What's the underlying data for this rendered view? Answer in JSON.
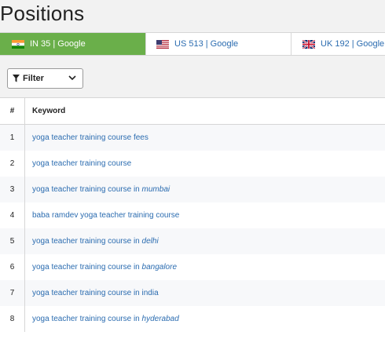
{
  "page": {
    "title": "Positions"
  },
  "tabs": [
    {
      "label": "IN 35 | Google",
      "flag": "flag-in-icon",
      "active": true
    },
    {
      "label": "US 513 | Google",
      "flag": "flag-us-icon",
      "active": false
    },
    {
      "label": "UK 192 | Google",
      "flag": "flag-uk-icon",
      "active": false
    }
  ],
  "filter": {
    "label": "Filter"
  },
  "table": {
    "headers": {
      "num": "#",
      "keyword": "Keyword"
    },
    "rows": [
      {
        "num": "1",
        "keyword": "yoga teacher training course fees",
        "suffix": ""
      },
      {
        "num": "2",
        "keyword": "yoga teacher training course",
        "suffix": ""
      },
      {
        "num": "3",
        "keyword": "yoga teacher training course in ",
        "suffix": "mumbai"
      },
      {
        "num": "4",
        "keyword": "baba ramdev yoga teacher training course",
        "suffix": ""
      },
      {
        "num": "5",
        "keyword": "yoga teacher training course in ",
        "suffix": "delhi"
      },
      {
        "num": "6",
        "keyword": "yoga teacher training course in ",
        "suffix": "bangalore"
      },
      {
        "num": "7",
        "keyword": "yoga teacher training course in india",
        "suffix": ""
      },
      {
        "num": "8",
        "keyword": "yoga teacher training course in ",
        "suffix": "hyderabad"
      }
    ]
  },
  "colors": {
    "active_tab": "#6aaf4a",
    "link": "#2b6cb0"
  }
}
